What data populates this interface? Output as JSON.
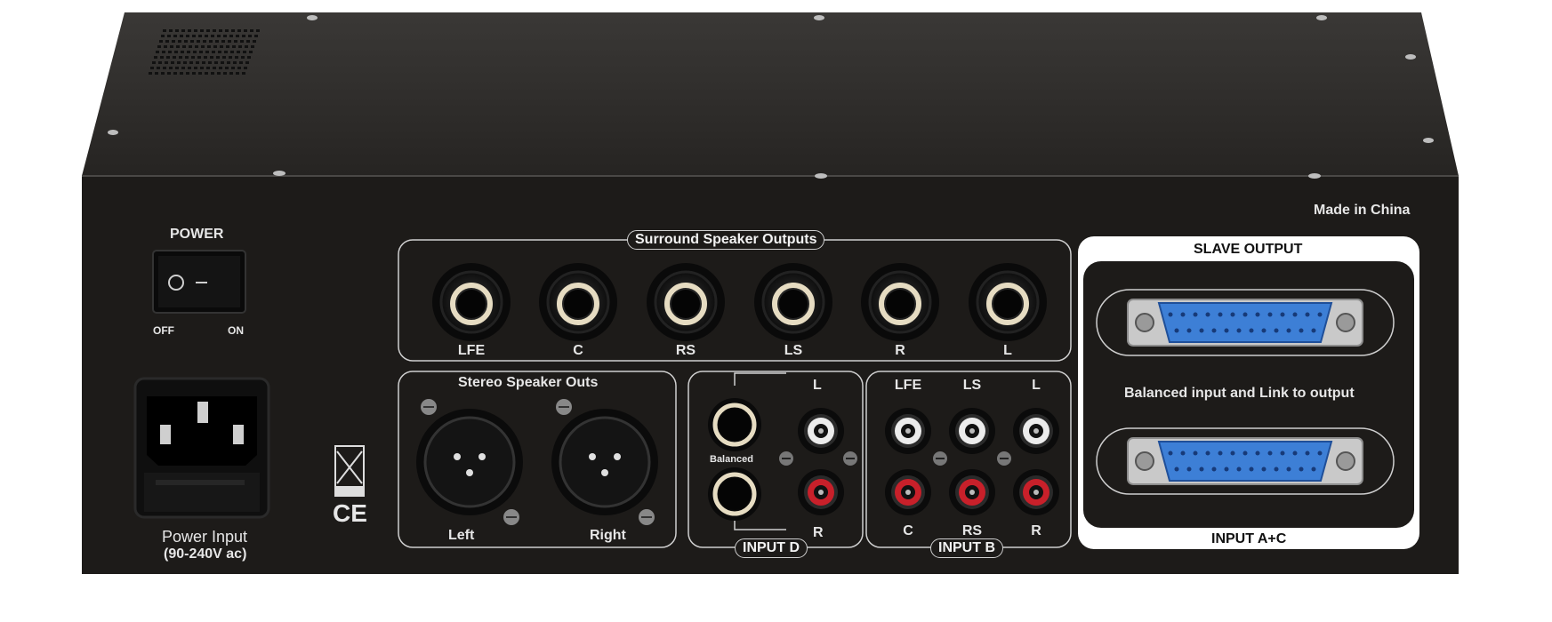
{
  "labels": {
    "power": "POWER",
    "switch_off": "OFF",
    "switch_on": "ON",
    "made_in": "Made in China",
    "surround_title": "Surround Speaker  Outputs",
    "surround_channels": [
      "LFE",
      "C",
      "RS",
      "LS",
      "R",
      "L"
    ],
    "stereo_title": "Stereo Speaker Outs",
    "stereo_left": "Left",
    "stereo_right": "Right",
    "input_d_title": "INPUT D",
    "input_d_l": "L",
    "input_d_r": "R",
    "input_d_balanced": "Balanced",
    "input_b_title": "INPUT B",
    "input_b_top": [
      "LFE",
      "LS",
      "L"
    ],
    "input_b_bottom": [
      "C",
      "RS",
      "R"
    ],
    "slave_output": "SLAVE OUTPUT",
    "link_text": "Balanced input and Link to output",
    "input_ac": "INPUT A+C",
    "power_input": "Power Input",
    "power_input_range": "(90-240V ac)",
    "ce_mark": "CE"
  },
  "colors": {
    "chassis_top": "#2e2c2a",
    "panel": "#1d1b19",
    "outline": "#cfcfcf",
    "rca_white": "#ececec",
    "rca_red": "#c8202a",
    "dsub_blue": "#3d7fd6"
  }
}
